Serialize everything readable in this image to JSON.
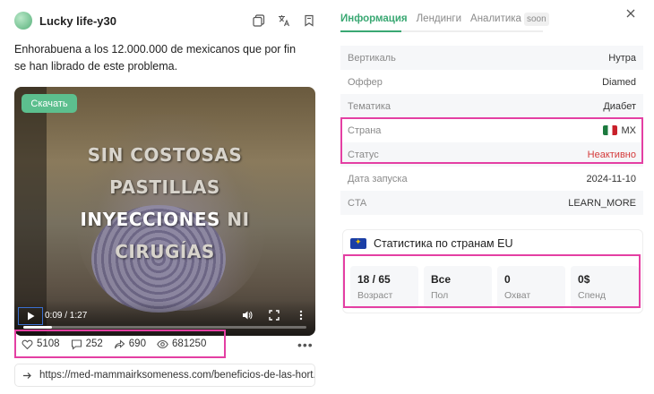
{
  "profile": {
    "name": "Lucky life-y30",
    "description": "Enhorabuena a los 12.000.000 de mexicanos que por fin se han librado de este problema."
  },
  "video": {
    "download_label": "Скачать",
    "overlay_lines": [
      "SIN COSTOSAS",
      "PASTILLAS",
      "INYECCIONES",
      "NI",
      "CIRUGÍAS"
    ],
    "time": "0:09 / 1:27",
    "progress": 0.1
  },
  "stats": {
    "likes": "5108",
    "comments": "252",
    "shares": "690",
    "views": "681250"
  },
  "url": "https://med-mammairksomeness.com/beneficios-de-las-hort...",
  "tabs": {
    "info": "Информация",
    "landings": "Лендинги",
    "analytics": "Аналитика",
    "soon": "soon"
  },
  "info": {
    "vertical": {
      "label": "Вертикаль",
      "value": "Нутра"
    },
    "offer": {
      "label": "Оффер",
      "value": "Diamed"
    },
    "theme": {
      "label": "Тематика",
      "value": "Диабет"
    },
    "country": {
      "label": "Страна",
      "value": "MX"
    },
    "status": {
      "label": "Статус",
      "value": "Неактивно"
    },
    "launch": {
      "label": "Дата запуска",
      "value": "2024-11-10"
    },
    "cta": {
      "label": "CTA",
      "value": "LEARN_MORE"
    }
  },
  "eu_stats": {
    "title": "Статистика по странам EU",
    "age": {
      "value": "18 / 65",
      "label": "Возраст"
    },
    "gender": {
      "value": "Все",
      "label": "Пол"
    },
    "reach": {
      "value": "0",
      "label": "Охват"
    },
    "spend": {
      "value": "0",
      "unit": "$",
      "label": "Спенд"
    }
  },
  "colors": {
    "accent": "#3aa873",
    "highlight": "#e43fa3",
    "inactive": "#d43a3a",
    "download_button": "#5cbf8e"
  }
}
